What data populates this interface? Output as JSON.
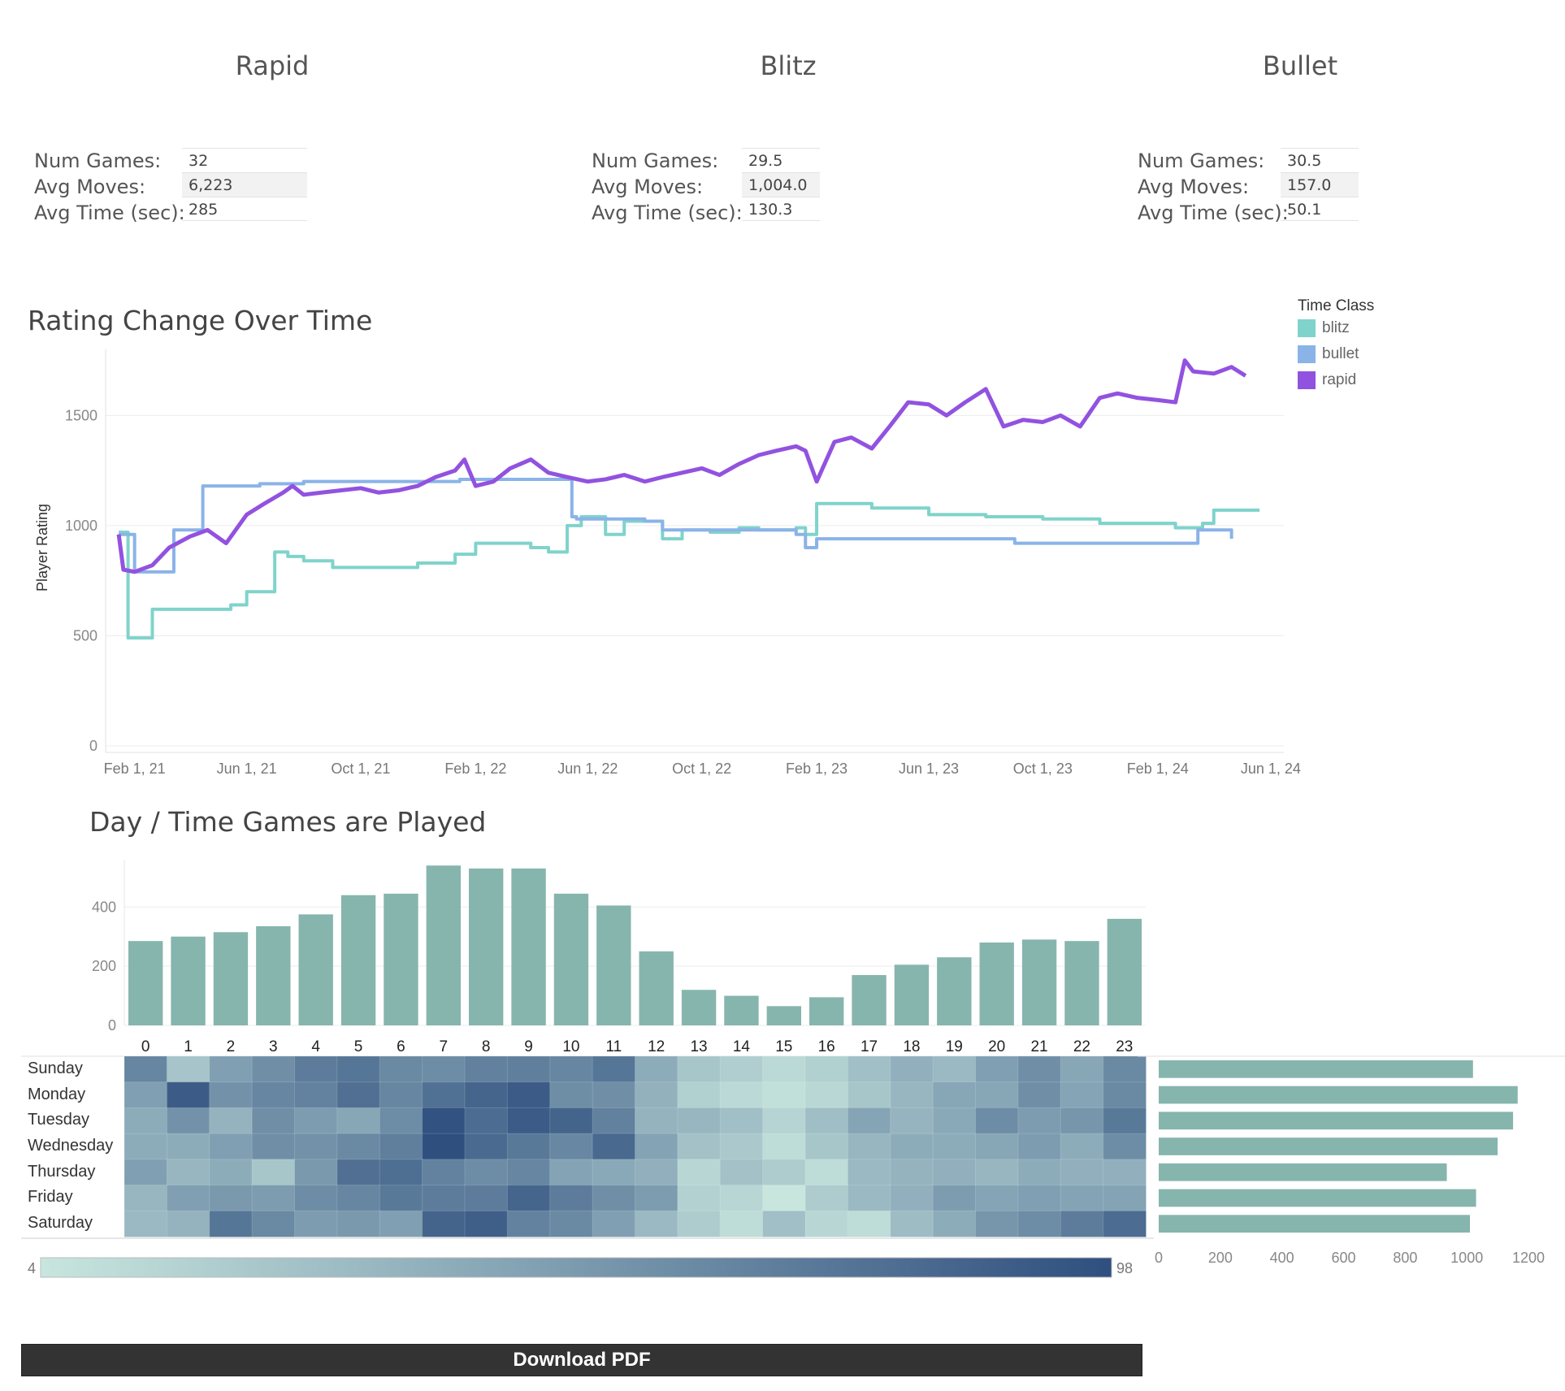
{
  "colors": {
    "blitz": "#7fd3cb",
    "bullet": "#8ab3e8",
    "rapid": "#9252e0",
    "bar": "#86b5ae",
    "heat_low": "#c8e6de",
    "heat_high": "#2f4f7f",
    "download_bg": "#333333"
  },
  "kpis": [
    {
      "title": "Rapid",
      "labels": [
        "Num Games:",
        "Avg Moves:",
        "Avg Time (sec):"
      ],
      "values": [
        "32",
        "6,223",
        "285"
      ]
    },
    {
      "title": "Blitz",
      "labels": [
        "Num Games:",
        "Avg Moves:",
        "Avg Time (sec):"
      ],
      "values": [
        "29.5",
        "1,004.0",
        "130.3"
      ]
    },
    {
      "title": "Bullet",
      "labels": [
        "Num Games:",
        "Avg Moves:",
        "Avg Time (sec):"
      ],
      "values": [
        "30.5",
        "157.0",
        "50.1"
      ]
    }
  ],
  "rating_chart": {
    "title": "Rating Change Over Time",
    "ylabel": "Player Rating",
    "yticks": [
      "0",
      "500",
      "1000",
      "1500"
    ],
    "xticks": [
      "Feb 1, 21",
      "Jun 1, 21",
      "Oct 1, 21",
      "Feb 1, 22",
      "Jun 1, 22",
      "Oct 1, 22",
      "Feb 1, 23",
      "Jun 1, 23",
      "Oct 1, 23",
      "Feb 1, 24",
      "Jun 1, 24"
    ],
    "legend_title": "Time Class",
    "legend": [
      "blitz",
      "bullet",
      "rapid"
    ]
  },
  "activity": {
    "title": "Day / Time Games are Played",
    "hour_yticks": [
      "0",
      "200",
      "400"
    ],
    "day_xticks": [
      "0",
      "200",
      "400",
      "600",
      "800",
      "1000",
      "1200"
    ],
    "colorbar_min": "4",
    "colorbar_max": "98"
  },
  "download_label": "Download PDF",
  "chart_data": [
    {
      "type": "line",
      "title": "Rating Change Over Time",
      "xlabel": "",
      "ylabel": "Player Rating",
      "x_range": [
        "2021-01-01",
        "2024-06-15"
      ],
      "ylim": [
        0,
        1800
      ],
      "grid": true,
      "legend_placement": "top-right",
      "series": [
        {
          "name": "rapid",
          "x": [
            "2021-01-15",
            "2021-01-20",
            "2021-02-01",
            "2021-02-20",
            "2021-03-10",
            "2021-04-01",
            "2021-04-20",
            "2021-05-10",
            "2021-06-01",
            "2021-06-20",
            "2021-07-10",
            "2021-07-20",
            "2021-08-01",
            "2021-08-20",
            "2021-09-10",
            "2021-10-01",
            "2021-10-20",
            "2021-11-10",
            "2021-12-01",
            "2021-12-20",
            "2022-01-10",
            "2022-01-20",
            "2022-02-01",
            "2022-02-20",
            "2022-03-10",
            "2022-04-01",
            "2022-04-20",
            "2022-05-10",
            "2022-06-01",
            "2022-06-20",
            "2022-07-10",
            "2022-08-01",
            "2022-08-20",
            "2022-09-10",
            "2022-10-01",
            "2022-10-20",
            "2022-11-10",
            "2022-12-01",
            "2022-12-20",
            "2023-01-10",
            "2023-01-20",
            "2023-02-01",
            "2023-02-20",
            "2023-03-10",
            "2023-04-01",
            "2023-04-20",
            "2023-05-10",
            "2023-06-01",
            "2023-06-20",
            "2023-07-10",
            "2023-08-01",
            "2023-08-20",
            "2023-09-10",
            "2023-10-01",
            "2023-10-20",
            "2023-11-10",
            "2023-12-01",
            "2023-12-20",
            "2024-01-10",
            "2024-02-01",
            "2024-02-20",
            "2024-03-01",
            "2024-03-10",
            "2024-04-01",
            "2024-04-20",
            "2024-05-05"
          ],
          "values": [
            960,
            800,
            790,
            820,
            900,
            950,
            980,
            920,
            1050,
            1100,
            1150,
            1180,
            1140,
            1150,
            1160,
            1170,
            1150,
            1160,
            1180,
            1220,
            1250,
            1300,
            1180,
            1200,
            1260,
            1300,
            1240,
            1220,
            1200,
            1210,
            1230,
            1200,
            1220,
            1240,
            1260,
            1230,
            1280,
            1320,
            1340,
            1360,
            1340,
            1200,
            1380,
            1400,
            1350,
            1450,
            1560,
            1550,
            1500,
            1560,
            1620,
            1450,
            1480,
            1470,
            1500,
            1450,
            1580,
            1600,
            1580,
            1570,
            1560,
            1750,
            1700,
            1690,
            1720,
            1680
          ]
        },
        {
          "name": "bullet",
          "x": [
            "2021-01-15",
            "2021-02-01",
            "2021-03-15",
            "2021-04-15",
            "2021-05-01",
            "2021-06-15",
            "2021-08-01",
            "2021-09-15",
            "2022-01-15",
            "2022-05-15",
            "2022-05-20",
            "2022-08-01",
            "2022-08-20",
            "2022-12-01",
            "2023-01-10",
            "2023-01-20",
            "2023-02-01",
            "2023-07-01",
            "2023-09-01",
            "2024-03-15",
            "2024-04-20"
          ],
          "values": [
            960,
            790,
            980,
            1180,
            1180,
            1190,
            1200,
            1200,
            1210,
            1040,
            1030,
            1020,
            980,
            980,
            960,
            900,
            940,
            940,
            920,
            980,
            940
          ]
        },
        {
          "name": "blitz",
          "x": [
            "2021-01-15",
            "2021-01-25",
            "2021-02-15",
            "2021-02-20",
            "2021-03-10",
            "2021-04-10",
            "2021-05-15",
            "2021-06-01",
            "2021-07-01",
            "2021-07-15",
            "2021-08-01",
            "2021-09-01",
            "2021-10-10",
            "2021-12-01",
            "2022-01-10",
            "2022-02-01",
            "2022-04-01",
            "2022-04-20",
            "2022-05-10",
            "2022-05-25",
            "2022-06-20",
            "2022-07-10",
            "2022-08-20",
            "2022-09-10",
            "2022-10-10",
            "2022-11-10",
            "2022-12-01",
            "2023-01-10",
            "2023-01-20",
            "2023-02-01",
            "2023-04-01",
            "2023-06-01",
            "2023-08-01",
            "2023-10-01",
            "2023-12-01",
            "2024-01-01",
            "2024-02-01",
            "2024-02-20",
            "2024-03-20",
            "2024-04-01",
            "2024-05-20"
          ],
          "values": [
            970,
            490,
            490,
            620,
            620,
            620,
            640,
            700,
            880,
            860,
            840,
            810,
            810,
            830,
            870,
            920,
            900,
            880,
            1000,
            1040,
            960,
            1020,
            940,
            980,
            970,
            990,
            980,
            990,
            960,
            1100,
            1080,
            1050,
            1040,
            1030,
            1010,
            1010,
            1010,
            990,
            1010,
            1070,
            1070
          ]
        }
      ]
    },
    {
      "type": "bar",
      "title": "Day / Time Games are Played",
      "xlabel": "",
      "ylabel": "",
      "categories": [
        "0",
        "1",
        "2",
        "3",
        "4",
        "5",
        "6",
        "7",
        "8",
        "9",
        "10",
        "11",
        "12",
        "13",
        "14",
        "15",
        "16",
        "17",
        "18",
        "19",
        "20",
        "21",
        "22",
        "23"
      ],
      "values": [
        285,
        300,
        315,
        335,
        375,
        440,
        445,
        540,
        530,
        530,
        445,
        405,
        250,
        120,
        100,
        65,
        95,
        170,
        205,
        230,
        280,
        290,
        285,
        360
      ],
      "ylim": [
        0,
        560
      ]
    },
    {
      "type": "heatmap",
      "title": "",
      "x": [
        "0",
        "1",
        "2",
        "3",
        "4",
        "5",
        "6",
        "7",
        "8",
        "9",
        "10",
        "11",
        "12",
        "13",
        "14",
        "15",
        "16",
        "17",
        "18",
        "19",
        "20",
        "21",
        "22",
        "23"
      ],
      "y": [
        "Sunday",
        "Monday",
        "Tuesday",
        "Wednesday",
        "Thursday",
        "Friday",
        "Saturday"
      ],
      "zlim": [
        4,
        98
      ],
      "values": [
        [
          64,
          25,
          48,
          58,
          70,
          74,
          62,
          60,
          67,
          68,
          64,
          74,
          40,
          24,
          19,
          12,
          18,
          28,
          38,
          32,
          48,
          58,
          44,
          62
        ],
        [
          48,
          90,
          56,
          64,
          66,
          78,
          64,
          77,
          84,
          90,
          59,
          58,
          37,
          18,
          12,
          8,
          13,
          24,
          34,
          44,
          44,
          58,
          45,
          62
        ],
        [
          40,
          56,
          36,
          58,
          50,
          44,
          60,
          96,
          80,
          90,
          85,
          67,
          36,
          34,
          28,
          15,
          29,
          45,
          35,
          42,
          60,
          50,
          54,
          72
        ],
        [
          40,
          40,
          48,
          58,
          56,
          62,
          68,
          98,
          81,
          72,
          63,
          82,
          46,
          27,
          22,
          10,
          24,
          34,
          40,
          40,
          44,
          50,
          40,
          60
        ],
        [
          48,
          34,
          40,
          24,
          52,
          78,
          79,
          66,
          60,
          64,
          46,
          42,
          38,
          14,
          27,
          20,
          10,
          32,
          36,
          38,
          34,
          40,
          38,
          38
        ],
        [
          34,
          48,
          52,
          50,
          60,
          64,
          72,
          70,
          70,
          84,
          70,
          58,
          50,
          17,
          14,
          4,
          20,
          32,
          38,
          50,
          45,
          48,
          46,
          46
        ],
        [
          32,
          36,
          74,
          62,
          50,
          52,
          48,
          85,
          88,
          66,
          62,
          48,
          32,
          20,
          10,
          28,
          14,
          10,
          30,
          40,
          54,
          60,
          70,
          80
        ]
      ]
    },
    {
      "type": "bar",
      "orientation": "horizontal",
      "title": "",
      "categories": [
        "Sunday",
        "Monday",
        "Tuesday",
        "Wednesday",
        "Thursday",
        "Friday",
        "Saturday"
      ],
      "values": [
        1020,
        1165,
        1150,
        1100,
        935,
        1030,
        1010
      ],
      "xlim": [
        0,
        1250
      ]
    }
  ]
}
